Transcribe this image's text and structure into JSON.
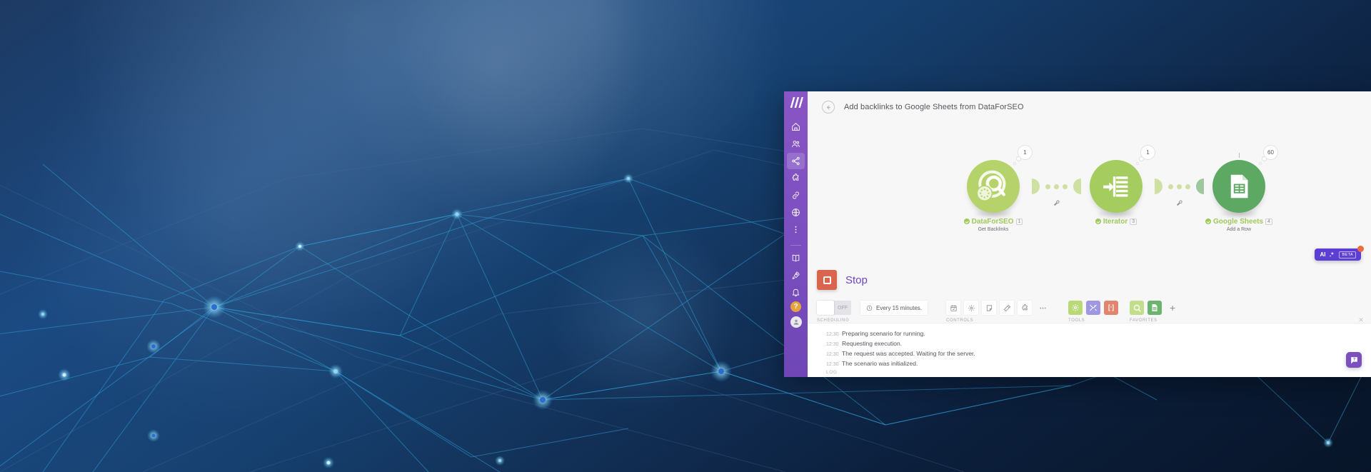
{
  "background": {
    "style": "dark-blue-network-gradient",
    "colors": {
      "deep": "#081529",
      "mid": "#16406f",
      "light": "#1b4a82",
      "node": "#3fb8e8",
      "line": "#2f9fd6"
    }
  },
  "sidebar": {
    "logo": "make-logo",
    "items": [
      {
        "name": "sidebar-item-home",
        "icon": "home-icon",
        "active": false
      },
      {
        "name": "sidebar-item-team",
        "icon": "users-icon",
        "active": false
      },
      {
        "name": "sidebar-item-scenarios",
        "icon": "share-nodes-icon",
        "active": true
      },
      {
        "name": "sidebar-item-templates",
        "icon": "puzzle-icon",
        "active": false
      },
      {
        "name": "sidebar-item-connections",
        "icon": "link-icon",
        "active": false
      },
      {
        "name": "sidebar-item-webhooks",
        "icon": "globe-icon",
        "active": false
      },
      {
        "name": "sidebar-item-more",
        "icon": "kebab-menu-icon",
        "active": false
      }
    ],
    "bottom_items": [
      {
        "name": "sidebar-item-docs",
        "icon": "book-icon"
      },
      {
        "name": "sidebar-item-whats-new",
        "icon": "rocket-icon"
      },
      {
        "name": "sidebar-item-notifications",
        "icon": "bell-icon"
      }
    ],
    "help_label": "?",
    "avatar": "user-avatar"
  },
  "header": {
    "back_icon": "arrow-left-icon",
    "title": "Add backlinks to Google Sheets from DataForSEO"
  },
  "scenario": {
    "modules": [
      {
        "name": "DataForSEO",
        "number": "1",
        "action": "Get Backlinks",
        "bubble": "1",
        "icon": "dataforseo-icon",
        "color": "#b5d36a"
      },
      {
        "name": "Iterator",
        "number": "3",
        "action": "",
        "bubble": "1",
        "icon": "iterator-icon",
        "color": "#a5cc5f"
      },
      {
        "name": "Google Sheets",
        "number": "4",
        "action": "Add a Row",
        "bubble": "60",
        "icon": "google-sheets-icon",
        "color": "#5da863"
      }
    ]
  },
  "toolbar": {
    "run": {
      "label": "Stop",
      "icon": "stop-square-icon",
      "color": "#d9654e"
    },
    "scheduling": {
      "caption": "SCHEDULING",
      "toggle_state": "OFF",
      "interval_label": "Every 15 minutes.",
      "clock_icon": "clock-icon"
    },
    "controls": {
      "caption": "CONTROLS",
      "buttons": [
        {
          "name": "schedule-setting-button",
          "icon": "calendar-check-icon"
        },
        {
          "name": "scenario-settings-button",
          "icon": "gear-icon"
        },
        {
          "name": "notes-button",
          "icon": "note-icon"
        },
        {
          "name": "auto-align-button",
          "icon": "magic-wand-icon"
        },
        {
          "name": "add-module-button",
          "icon": "puzzle-plus-icon"
        },
        {
          "name": "more-controls-button",
          "icon": "ellipsis-icon"
        }
      ]
    },
    "tools": {
      "caption": "TOOLS",
      "buttons": [
        {
          "name": "tools-flow-control-button",
          "icon": "gear-icon",
          "color": "#b9d977"
        },
        {
          "name": "tools-utilities-button",
          "icon": "tools-icon",
          "color": "#9f97e0"
        },
        {
          "name": "tools-text-parser-button",
          "icon": "brackets-icon",
          "color": "#e08670"
        }
      ]
    },
    "favorites": {
      "caption": "FAVORITES",
      "buttons": [
        {
          "name": "favorite-dataforseo-button",
          "icon": "dataforseo-icon",
          "color": "#c3de8a"
        },
        {
          "name": "favorite-google-sheets-button",
          "icon": "google-sheets-icon",
          "color": "#6bb36f"
        }
      ],
      "add_label": "+"
    }
  },
  "log": {
    "caption": "LOG",
    "close_label": "✕",
    "entries": [
      {
        "time": "12:30",
        "message": "Preparing scenario for running."
      },
      {
        "time": "12:30",
        "message": "Requesting execution."
      },
      {
        "time": "12:30",
        "message": "The request was accepted. Waiting for the server."
      },
      {
        "time": "12:30",
        "message": "The scenario was initialized."
      }
    ]
  },
  "ai_badge": {
    "label": "AI",
    "tag": "BETA",
    "icon": "sparkle-icon",
    "color": "#5b3fd4",
    "dot_color": "#ef6b45"
  },
  "help_fab": {
    "icon": "help-chat-icon",
    "color": "#7b4fc0"
  }
}
